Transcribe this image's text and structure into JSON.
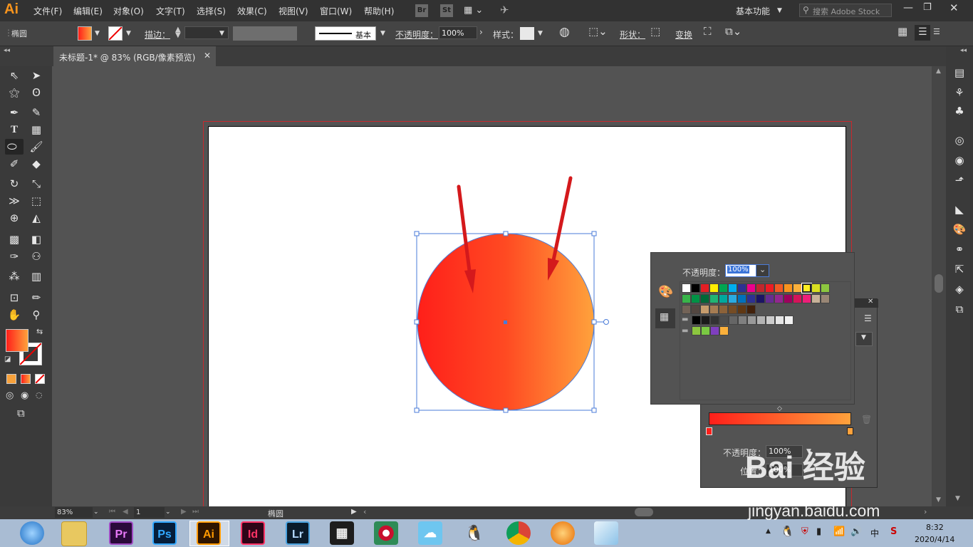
{
  "app": {
    "logo": "Ai"
  },
  "menu": [
    "文件(F)",
    "编辑(E)",
    "对象(O)",
    "文字(T)",
    "选择(S)",
    "效果(C)",
    "视图(V)",
    "窗口(W)",
    "帮助(H)"
  ],
  "bridge_buttons": [
    "Br",
    "St"
  ],
  "workspace": "基本功能",
  "search_placeholder": "搜索 Adobe Stock",
  "control": {
    "object_type": "椭圆",
    "stroke_label": "描边：",
    "stroke_style": "基本",
    "opacity_label": "不透明度：",
    "opacity_value": "100%",
    "style_label": "样式：",
    "shape_label": "形状：",
    "transform_label": "变换"
  },
  "document_tab": {
    "title": "未标题-1* @ 83% (RGB/像素预览)"
  },
  "swatch_panel": {
    "opacity_label": "不透明度：",
    "opacity_value": "100%",
    "row1": [
      "#ffffff",
      "#000000",
      "#e31e24",
      "#ffed00",
      "#00a651",
      "#00aeef",
      "#2e3192",
      "#ec008c",
      "#c1272d",
      "#ed1c24",
      "#f15a24",
      "#f7931e",
      "#fbb03b",
      "#fcee21",
      "#d9e021",
      "#8cc63f"
    ],
    "row2": [
      "#39b54a",
      "#009245",
      "#006837",
      "#22b573",
      "#00a99d",
      "#29abe2",
      "#0071bc",
      "#2e3192",
      "#1b1464",
      "#662d91",
      "#93278f",
      "#9e005d",
      "#d4145a",
      "#ed1e79",
      "#c7b299",
      "#998675"
    ],
    "row3": [
      "#736357",
      "#534741",
      "#c69c6d",
      "#a67c52",
      "#8c6239",
      "#754c24",
      "#603813",
      "#42210b"
    ],
    "gray_row": [
      "#000000",
      "#1a1a1a",
      "#333333",
      "#4d4d4d",
      "#666666",
      "#808080",
      "#999999",
      "#b3b3b3",
      "#cccccc",
      "#e6e6e6",
      "#f2f2f2"
    ],
    "color_group": [
      "#8cc63f",
      "#7ac943",
      "#7f3fbf",
      "#fbb03b"
    ]
  },
  "gradient_panel": {
    "opacity_label": "不透明度：",
    "opacity_value": "100%",
    "location_label": "位置：",
    "location_value": "100%"
  },
  "status": {
    "zoom": "83%",
    "page": "1",
    "tool_name": "椭圆"
  },
  "taskbar": {
    "apps": [
      "Pr",
      "Ps",
      "Ai",
      "Id",
      "Lr"
    ],
    "time": "8:32",
    "date": "2020/4/14",
    "ime": "中"
  },
  "watermark": {
    "brand": "Bai 经验",
    "url": "jingyan.baidu.com"
  },
  "colors": {
    "gradient_start": "#ff1f1a",
    "gradient_end": "#ffa23c",
    "selection": "#4a7bd8",
    "arrow": "#d4191c"
  }
}
